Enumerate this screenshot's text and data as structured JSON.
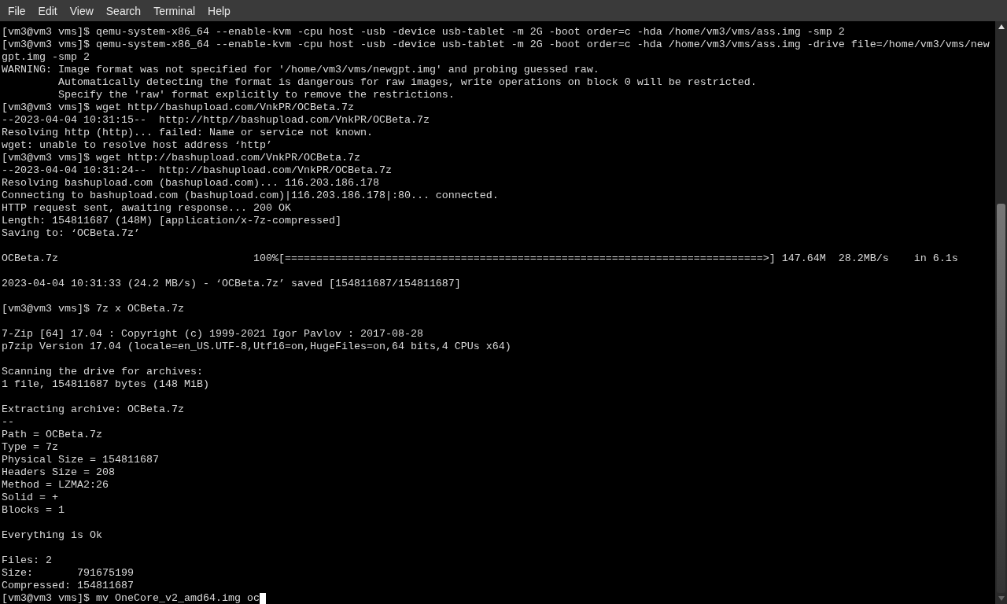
{
  "menu_bar": [
    "File",
    "Edit",
    "View",
    "Search",
    "Terminal",
    "Help"
  ],
  "terminal": {
    "lines": [
      {
        "kind": "text",
        "text": "[vm3@vm3 vms]$ qemu-system-x86_64 --enable-kvm -cpu host -usb -device usb-tablet -m 2G -boot order=c -hda /home/vm3/vms/ass.img -smp 2"
      },
      {
        "kind": "text",
        "text": "[vm3@vm3 vms]$ qemu-system-x86_64 --enable-kvm -cpu host -usb -device usb-tablet -m 2G -boot order=c -hda /home/vm3/vms/ass.img -drive file=/home/vm3/vms/new"
      },
      {
        "kind": "text",
        "text": "gpt.img -smp 2"
      },
      {
        "kind": "text",
        "text": "WARNING: Image format was not specified for '/home/vm3/vms/newgpt.img' and probing guessed raw."
      },
      {
        "kind": "text",
        "text": "         Automatically detecting the format is dangerous for raw images, write operations on block 0 will be restricted."
      },
      {
        "kind": "text",
        "text": "         Specify the 'raw' format explicitly to remove the restrictions."
      },
      {
        "kind": "text",
        "text": "[vm3@vm3 vms]$ wget http//bashupload.com/VnkPR/OCBeta.7z"
      },
      {
        "kind": "text",
        "text": "--2023-04-04 10:31:15--  http://http//bashupload.com/VnkPR/OCBeta.7z"
      },
      {
        "kind": "text",
        "text": "Resolving http (http)... failed: Name or service not known."
      },
      {
        "kind": "text",
        "text": "wget: unable to resolve host address ‘http’"
      },
      {
        "kind": "text",
        "text": "[vm3@vm3 vms]$ wget http://bashupload.com/VnkPR/OCBeta.7z"
      },
      {
        "kind": "text",
        "text": "--2023-04-04 10:31:24--  http://bashupload.com/VnkPR/OCBeta.7z"
      },
      {
        "kind": "text",
        "text": "Resolving bashupload.com (bashupload.com)... 116.203.186.178"
      },
      {
        "kind": "text",
        "text": "Connecting to bashupload.com (bashupload.com)|116.203.186.178|:80... connected."
      },
      {
        "kind": "text",
        "text": "HTTP request sent, awaiting response... 200 OK"
      },
      {
        "kind": "text",
        "text": "Length: 154811687 (148M) [application/x-7z-compressed]"
      },
      {
        "kind": "text",
        "text": "Saving to: ‘OCBeta.7z’"
      },
      {
        "kind": "blank"
      },
      {
        "kind": "text",
        "text": "OCBeta.7z                               100%[============================================================================>] 147.64M  28.2MB/s    in 6.1s"
      },
      {
        "kind": "blank"
      },
      {
        "kind": "text",
        "text": "2023-04-04 10:31:33 (24.2 MB/s) - ‘OCBeta.7z’ saved [154811687/154811687]"
      },
      {
        "kind": "blank"
      },
      {
        "kind": "text",
        "text": "[vm3@vm3 vms]$ 7z x OCBeta.7z"
      },
      {
        "kind": "blank"
      },
      {
        "kind": "text",
        "text": "7-Zip [64] 17.04 : Copyright (c) 1999-2021 Igor Pavlov : 2017-08-28"
      },
      {
        "kind": "text",
        "text": "p7zip Version 17.04 (locale=en_US.UTF-8,Utf16=on,HugeFiles=on,64 bits,4 CPUs x64)"
      },
      {
        "kind": "blank"
      },
      {
        "kind": "text",
        "text": "Scanning the drive for archives:"
      },
      {
        "kind": "text",
        "text": "1 file, 154811687 bytes (148 MiB)"
      },
      {
        "kind": "blank"
      },
      {
        "kind": "text",
        "text": "Extracting archive: OCBeta.7z"
      },
      {
        "kind": "text",
        "text": "--"
      },
      {
        "kind": "text",
        "text": "Path = OCBeta.7z"
      },
      {
        "kind": "text",
        "text": "Type = 7z"
      },
      {
        "kind": "text",
        "text": "Physical Size = 154811687"
      },
      {
        "kind": "text",
        "text": "Headers Size = 208"
      },
      {
        "kind": "text",
        "text": "Method = LZMA2:26"
      },
      {
        "kind": "text",
        "text": "Solid = +"
      },
      {
        "kind": "text",
        "text": "Blocks = 1"
      },
      {
        "kind": "blank"
      },
      {
        "kind": "text",
        "text": "Everything is Ok"
      },
      {
        "kind": "blank"
      },
      {
        "kind": "text",
        "text": "Files: 2"
      },
      {
        "kind": "text",
        "text": "Size:       791675199"
      },
      {
        "kind": "text",
        "text": "Compressed: 154811687"
      },
      {
        "kind": "input",
        "text": "[vm3@vm3 vms]$ mv OneCore_v2_amd64.img oc"
      }
    ]
  }
}
